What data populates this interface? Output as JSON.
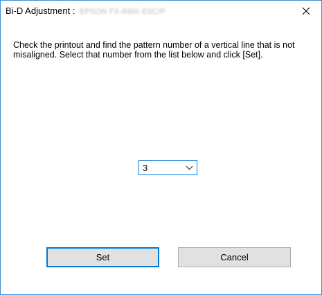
{
  "dialog": {
    "title_prefix": "Bi-D Adjustment :",
    "title_printer": "EPSON FX-890II ESC/P",
    "close_icon": "close-icon",
    "instructions": "Check the printout and find the pattern number of a vertical line that is not misaligned. Select that number from the list below and click [Set].",
    "pattern_select": {
      "selected": "3",
      "arrow_icon": "chevron-down-icon"
    },
    "buttons": {
      "set_label": "Set",
      "cancel_label": "Cancel"
    }
  },
  "colors": {
    "accent": "#0078d7",
    "window_border": "#3c8fd6",
    "button_face": "#e1e1e1"
  }
}
